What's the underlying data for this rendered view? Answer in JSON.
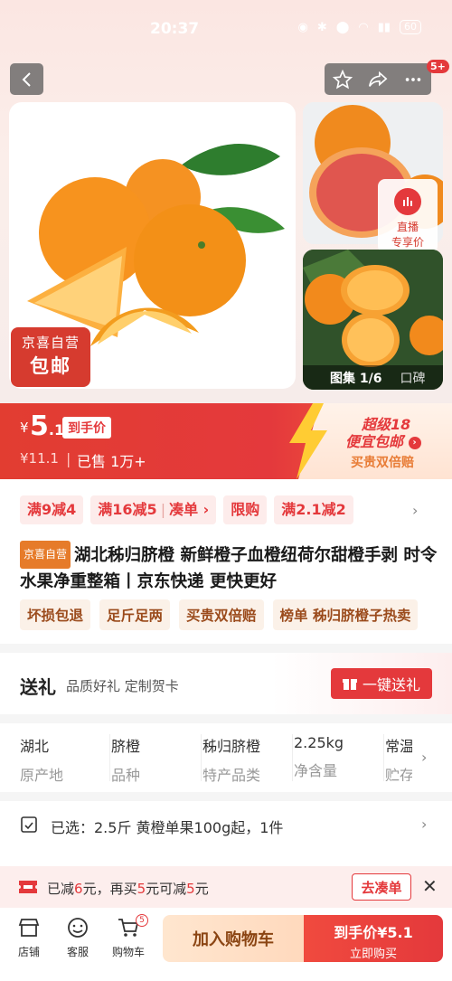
{
  "status": {
    "time": "20:37",
    "battery": "60"
  },
  "header": {
    "cart_badge": "5+"
  },
  "gallery": {
    "badge_line1": "京喜自营",
    "badge_line2": "包邮",
    "live_label_1": "直播",
    "live_label_2": "专享价",
    "gallery_label": "图集 1/6",
    "review_label": "口碑"
  },
  "price": {
    "currency": "¥",
    "integer": "5",
    "decimal": ".1",
    "tag": "到手价",
    "original": "¥11.1",
    "sold": "已售 1万+",
    "promo_line1": "超级18",
    "promo_line2": "便宜包邮",
    "promo_line3": "买贵双倍赔"
  },
  "promos": {
    "p1": "满9减4",
    "p2a": "满16减5",
    "p2b": "凑单 ›",
    "p3": "限购",
    "p4": "满2.1减2"
  },
  "product": {
    "tag": "京喜自营",
    "title": "湖北秭归脐橙 新鲜橙子血橙纽荷尔甜橙手剥 时令水果净重整箱丨京东快递 更快更好"
  },
  "chips": [
    "坏损包退",
    "足斤足两",
    "买贵双倍赔",
    "榜单  秭归脐橙子热卖"
  ],
  "gift": {
    "title": "送礼",
    "subtitle": "品质好礼 定制贺卡",
    "button": "一键送礼"
  },
  "specs": [
    {
      "value": "湖北",
      "key": "原产地"
    },
    {
      "value": "脐橙",
      "key": "品种"
    },
    {
      "value": "秭归脐橙",
      "key": "特产品类"
    },
    {
      "value": "2.25kg",
      "key": "净含量"
    },
    {
      "value": "常温",
      "key": "贮存"
    }
  ],
  "selected": {
    "text": "已选：2.5斤 黄橙单果100g起，1件"
  },
  "coupon": {
    "pre": "已减",
    "a": "6",
    "mid1": "元，再买",
    "b": "5",
    "mid2": "元可减",
    "c": "5",
    "post": "元",
    "button": "去凑单"
  },
  "bottom": {
    "store": "店铺",
    "service": "客服",
    "cart": "购物车",
    "cart_count": "5",
    "add_cart": "加入购物车",
    "buy_line1": "到手价¥5.1",
    "buy_line2": "立即购买"
  },
  "colors": {
    "accent": "#e4393c",
    "orange": "#e67b2a"
  }
}
